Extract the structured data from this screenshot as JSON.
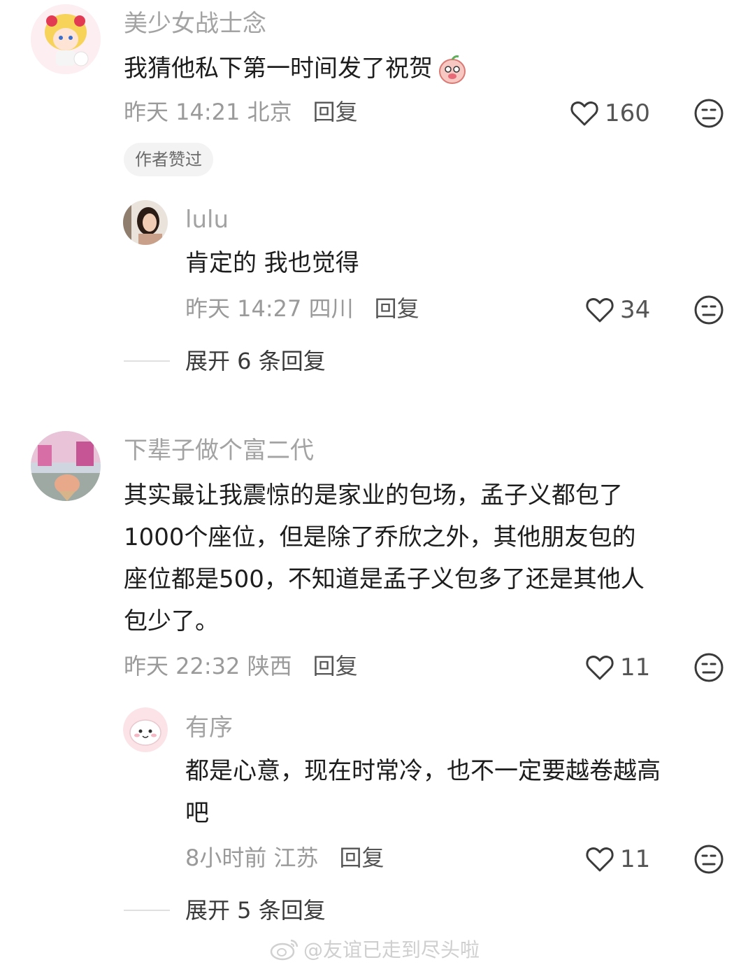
{
  "colors": {
    "username": "#a3a3a3",
    "meta": "#9a9a9a",
    "text": "#1d1d1d",
    "badge_bg": "#f3f3f3"
  },
  "comments": [
    {
      "username": "美少女战士念",
      "text": "我猜他私下第一时间发了祝贺",
      "emoji": "peach-blush-emoji",
      "time_location": "昨天 14:21 北京",
      "reply_label": "回复",
      "likes": "160",
      "badge": "作者赞过",
      "replies": [
        {
          "username": "lulu",
          "text": "肯定的 我也觉得",
          "time_location": "昨天 14:27 四川",
          "reply_label": "回复",
          "likes": "34"
        }
      ],
      "expand_label": "展开 6 条回复"
    },
    {
      "username": "下辈子做个富二代",
      "text_lines": [
        "其实最让我震惊的是家业的包场，孟子义都包了",
        "1000个座位，但是除了乔欣之外，其他朋友包的",
        "座位都是500，不知道是孟子义包多了还是其他人",
        "包少了。"
      ],
      "time_location": "昨天 22:32 陕西",
      "reply_label": "回复",
      "likes": "11",
      "replies": [
        {
          "username": "有序",
          "text_lines": [
            "都是心意，现在时常冷，也不一定要越卷越高",
            "吧"
          ],
          "time_location": "8小时前 江苏",
          "reply_label": "回复",
          "likes": "11"
        }
      ],
      "expand_label": "展开 5 条回复"
    }
  ],
  "watermark": "@友谊已走到尽头啦"
}
